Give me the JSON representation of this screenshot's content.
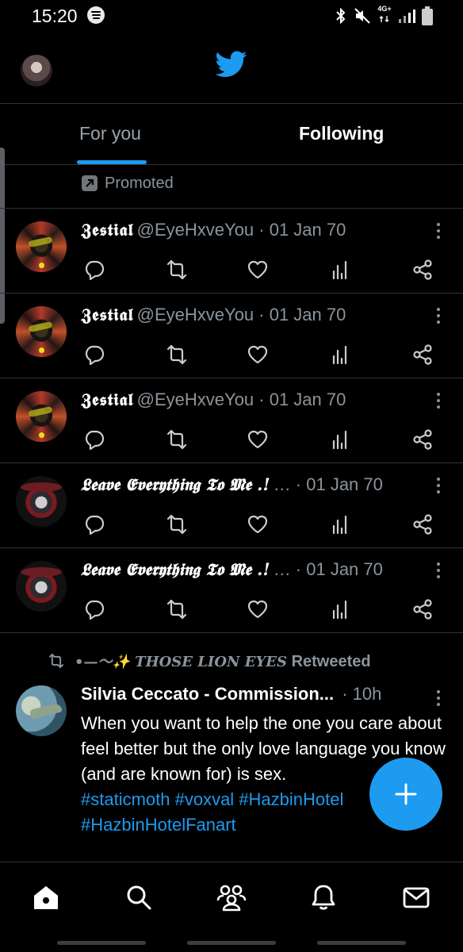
{
  "status_bar": {
    "time": "15:20",
    "network": "4G+"
  },
  "tabs": [
    {
      "label": "For you",
      "selected": true
    },
    {
      "label": "Following",
      "selected": false
    }
  ],
  "promoted_label": "Promoted",
  "tweets": [
    {
      "name": "𝖅𝖊𝖘𝖙𝖎𝖆𝖑",
      "meta": "@EyeHxveYou · 01 Jan 70",
      "avatar": "zestial"
    },
    {
      "name": "𝖅𝖊𝖘𝖙𝖎𝖆𝖑",
      "meta": "@EyeHxveYou · 01 Jan 70",
      "avatar": "zestial"
    },
    {
      "name": "𝖅𝖊𝖘𝖙𝖎𝖆𝖑",
      "meta": "@EyeHxveYou · 01 Jan 70",
      "avatar": "zestial"
    },
    {
      "name": "𝕷𝖊𝖆𝖛𝖊 𝕰𝖛𝖊𝖗𝖞𝖙𝖍𝖎𝖓𝖌 𝕿𝖔 𝕸𝖊 .!",
      "meta": "… · 01 Jan 70",
      "avatar": "leave"
    },
    {
      "name": "𝕷𝖊𝖆𝖛𝖊 𝕰𝖛𝖊𝖗𝖞𝖙𝖍𝖎𝖓𝖌 𝕿𝖔 𝕸𝖊 .!",
      "meta": "… · 01 Jan 70",
      "avatar": "leave"
    }
  ],
  "retweet": {
    "by": "•—〜✨ THOSE LION EYES",
    "label": "Retweeted",
    "author": "Silvia Ceccato - Commission...",
    "time": "· 10h",
    "text": "When you want to help the one you care about feel better but the only love language you know (and are known for) is sex.",
    "hashtags": "#staticmoth #voxval #HazbinHotel #HazbinHotelFanart"
  },
  "icons": {
    "header": "twitter-bird-icon",
    "actions": [
      "reply-icon",
      "retweet-icon",
      "like-icon",
      "views-icon",
      "share-icon"
    ],
    "nav": [
      "home-icon",
      "search-icon",
      "communities-icon",
      "notifications-icon",
      "messages-icon"
    ],
    "fab": "compose-plus-icon"
  },
  "colors": {
    "accent": "#1d9bf0",
    "background": "#000000",
    "muted": "#8b949c"
  }
}
